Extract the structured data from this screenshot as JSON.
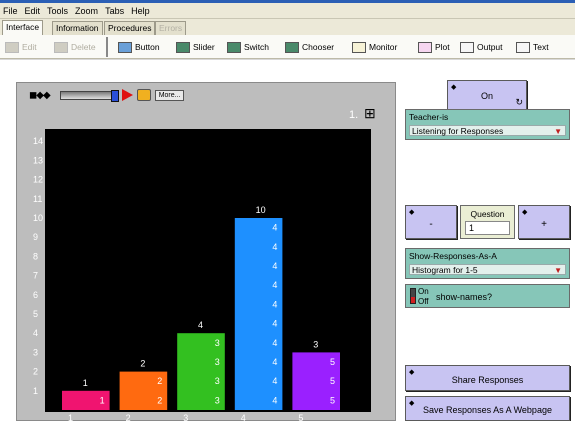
{
  "menu": [
    "File",
    "Edit",
    "Tools",
    "Zoom",
    "Tabs",
    "Help"
  ],
  "tabs": [
    {
      "label": "Interface",
      "active": true,
      "enabled": true
    },
    {
      "label": "Information",
      "active": false,
      "enabled": true
    },
    {
      "label": "Procedures",
      "active": false,
      "enabled": true
    },
    {
      "label": "Errors",
      "active": false,
      "enabled": false
    }
  ],
  "toolbar": {
    "edit": "Edit",
    "delete": "Delete",
    "button": "Button",
    "slider": "Slider",
    "switch": "Switch",
    "chooser": "Chooser",
    "monitor": "Monitor",
    "plot": "Plot",
    "output": "Output",
    "text": "Text"
  },
  "view": {
    "more": "More...",
    "ticks": "1."
  },
  "chart_data": {
    "type": "bar",
    "categories": [
      "1",
      "2",
      "3",
      "4",
      "5"
    ],
    "values": [
      1,
      2,
      4,
      10,
      3
    ],
    "colors": [
      "#f01470",
      "#ff6a10",
      "#33c020",
      "#1e90ff",
      "#9a20ff"
    ],
    "ylim": [
      0,
      14
    ],
    "yticks": [
      1,
      2,
      3,
      4,
      5,
      6,
      7,
      8,
      9,
      10,
      11,
      12,
      13,
      14
    ],
    "inner_labels": [
      "1",
      "2",
      "3",
      "4",
      "5"
    ],
    "grid": false
  },
  "controls": {
    "on_button": "On",
    "teacher_label": "Teacher-is",
    "teacher_value": "Listening for Responses",
    "prev_button": "-",
    "question_label": "Question",
    "question_value": "1",
    "next_button": "+",
    "show_label": "Show-Responses-As-A",
    "show_value": "Histogram for 1-5",
    "switch_on": "On",
    "switch_off": "Off",
    "switch_label": "show-names?",
    "share_button": "Share Responses",
    "save_button": "Save Responses As A Webpage"
  }
}
